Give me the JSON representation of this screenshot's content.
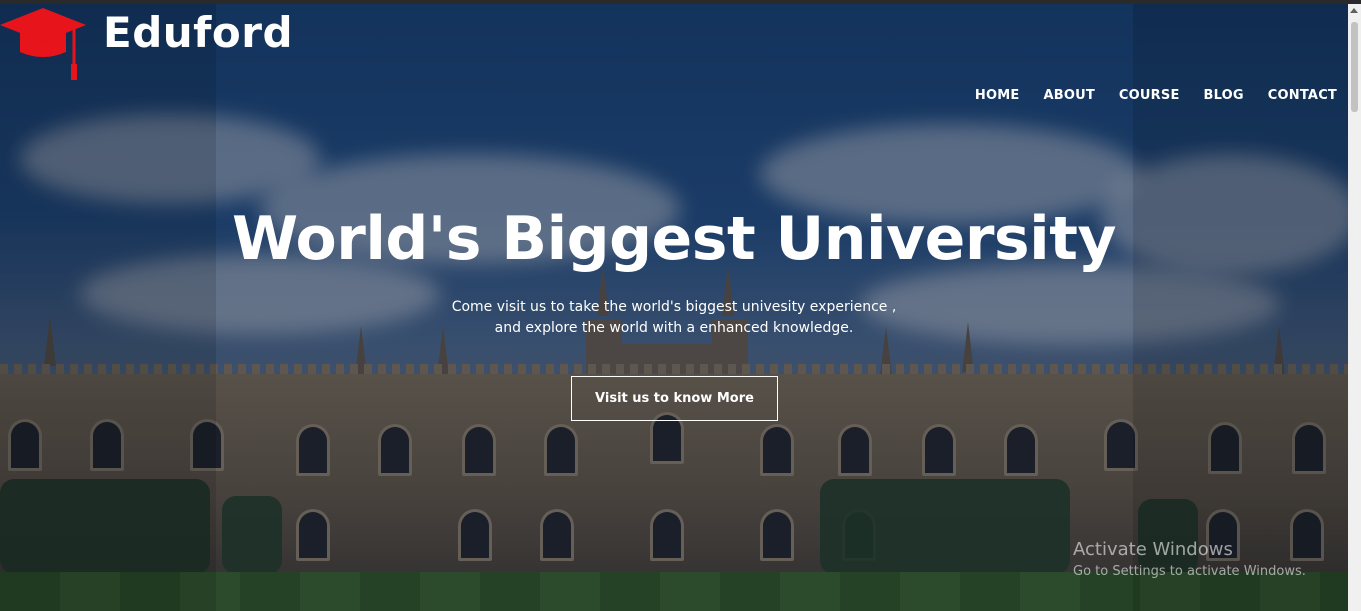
{
  "brand": {
    "name": "Eduford",
    "logo_icon": "graduation-cap-icon",
    "logo_color": "#e8141b"
  },
  "nav": {
    "items": [
      "HOME",
      "ABOUT",
      "COURSE",
      "BLOG",
      "CONTACT"
    ]
  },
  "hero": {
    "headline": "World's Biggest University",
    "subtext_line1": "Come visit us to take the world's biggest univesity experience ,",
    "subtext_line2": "and explore the world with a enhanced knowledge.",
    "cta_label": "Visit us to know More"
  },
  "watermark": {
    "title": "Activate Windows",
    "subtitle": "Go to Settings to activate Windows."
  }
}
